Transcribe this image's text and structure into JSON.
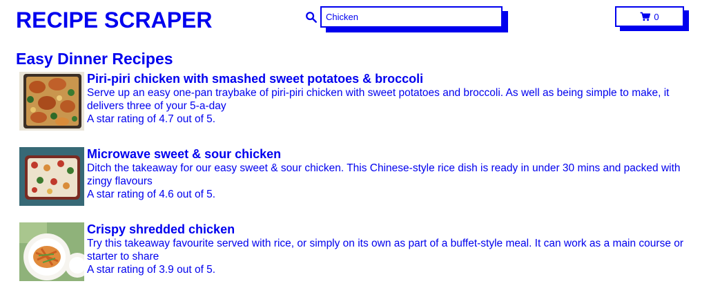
{
  "header": {
    "app_title": "RECIPE SCRAPER",
    "search": {
      "value": "Chicken",
      "icon": "search-icon"
    },
    "cart": {
      "icon": "shopping-cart-icon",
      "count": "0"
    }
  },
  "main": {
    "section_heading": "Easy Dinner Recipes",
    "recipes": [
      {
        "title": "Piri-piri chicken with smashed sweet potatoes & broccoli",
        "description": "Serve up an easy one-pan traybake of piri-piri chicken with sweet potatoes and broccoli. As well as being simple to make, it delivers three of your 5-a-day",
        "rating_text": "A star rating of 4.7 out of 5.",
        "rating": 4.7
      },
      {
        "title": "Microwave sweet & sour chicken",
        "description": "Ditch the takeaway for our easy sweet & sour chicken. This Chinese-style rice dish is ready in under 30 mins and packed with zingy flavours",
        "rating_text": "A star rating of 4.6 out of 5.",
        "rating": 4.6
      },
      {
        "title": "Crispy shredded chicken",
        "description": "Try this takeaway favourite served with rice, or simply on its own as part of a buffet-style meal. It can work as a main course or starter to share",
        "rating_text": "A star rating of 3.9 out of 5.",
        "rating": 3.9
      }
    ]
  },
  "colors": {
    "accent": "#0000ee",
    "background": "#ffffff"
  }
}
